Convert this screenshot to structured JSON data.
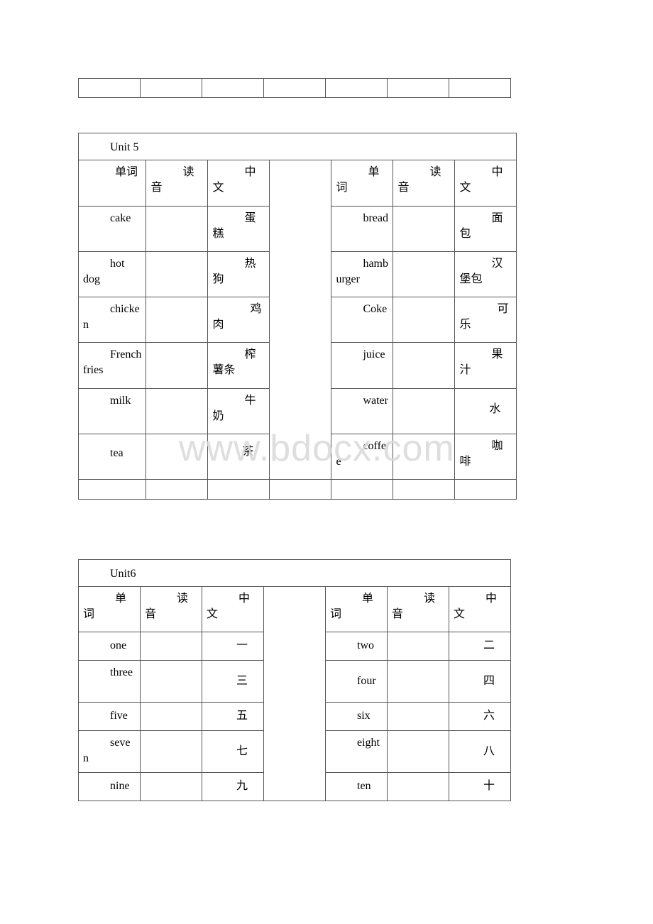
{
  "watermark": "www.bdocx.com",
  "unit5": {
    "title": "Unit 5",
    "headers": [
      "单词",
      "读音",
      "中文",
      "",
      "单词",
      "读音",
      "中文"
    ],
    "rows": [
      {
        "left_word": "cake",
        "left_zh": "蛋糕",
        "right_word": "bread",
        "right_zh": "面包"
      },
      {
        "left_word": "hot dog",
        "left_zh": "热狗",
        "right_word": "hamburger",
        "right_zh": "汉堡包"
      },
      {
        "left_word": "chicken",
        "left_zh": "鸡肉",
        "right_word": "Coke",
        "right_zh": "可乐"
      },
      {
        "left_word": "French fries",
        "left_zh": "榨薯条",
        "right_word": "juice",
        "right_zh": "果汁"
      },
      {
        "left_word": "milk",
        "left_zh": "牛奶",
        "right_word": "water",
        "right_zh": "水"
      },
      {
        "left_word": "tea",
        "left_zh": "茶",
        "right_word": "coffee",
        "right_zh": "咖啡"
      }
    ]
  },
  "unit6": {
    "title": "Unit6",
    "headers": [
      "单词",
      "读音",
      "中文",
      "",
      "单词",
      "读音",
      "中文"
    ],
    "rows": [
      {
        "left_word": "one",
        "left_zh": "一",
        "right_word": "two",
        "right_zh": "二"
      },
      {
        "left_word": "three",
        "left_zh": "三",
        "right_word": "four",
        "right_zh": "四"
      },
      {
        "left_word": "five",
        "left_zh": "五",
        "right_word": "six",
        "right_zh": "六"
      },
      {
        "left_word": "seven",
        "left_zh": "七",
        "right_word": "eight",
        "right_zh": "八"
      },
      {
        "left_word": "nine",
        "left_zh": "九",
        "right_word": "ten",
        "right_zh": "十"
      }
    ]
  }
}
